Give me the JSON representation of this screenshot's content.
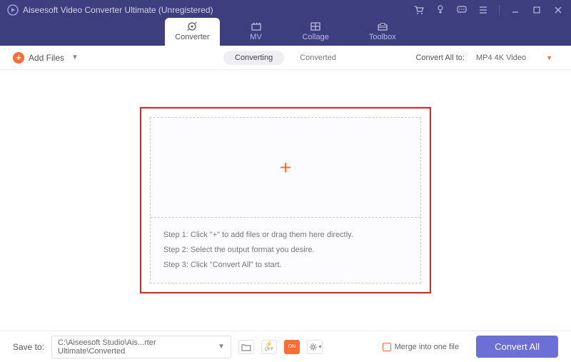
{
  "titlebar": {
    "app_title": "Aiseesoft Video Converter Ultimate (Unregistered)"
  },
  "tabs": {
    "converter": "Converter",
    "mv": "MV",
    "collage": "Collage",
    "toolbox": "Toolbox"
  },
  "toolbar": {
    "add_files": "Add Files",
    "converting": "Converting",
    "converted": "Converted",
    "convert_all_to": "Convert All to:",
    "format": "MP4 4K Video"
  },
  "dropzone": {
    "step1": "Step 1: Click \"+\" to add files or drag them here directly.",
    "step2": "Step 2: Select the output format you desire.",
    "step3": "Step 3: Click \"Convert All\" to start."
  },
  "footer": {
    "save_to": "Save to:",
    "path": "C:\\Aiseesoft Studio\\Ais...rter Ultimate\\Converted",
    "merge": "Merge into one file",
    "convert_all": "Convert All"
  }
}
